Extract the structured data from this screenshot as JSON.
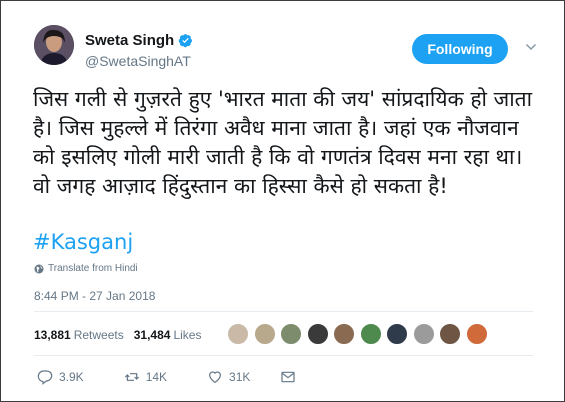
{
  "author": {
    "name": "Sweta Singh",
    "handle": "@SwetaSinghAT",
    "verified": true
  },
  "follow_button_label": "Following",
  "tweet": {
    "text": "जिस गली से गुज़रते हुए 'भारत माता की जय' सांप्रदायिक हो जाता है। जिस मुहल्ले में तिरंगा अवैध माना जाता है। जहां एक नौजवान को इसलिए गोली मारी जाती है कि वो गणतंत्र दिवस मना रहा था। वो जगह आज़ाद हिंदुस्तान का हिस्सा कैसे हो सकता है!",
    "hashtag": "#Kasganj",
    "translate_label": "Translate from Hindi",
    "timestamp": "8:44 PM - 27 Jan 2018"
  },
  "stats": {
    "retweets_count": "13,881",
    "retweets_label": "Retweets",
    "likes_count": "31,484",
    "likes_label": "Likes"
  },
  "likers": [
    {
      "color": "#c9b9a6"
    },
    {
      "color": "#b8a98c"
    },
    {
      "color": "#7e8c6e"
    },
    {
      "color": "#3b3a3a"
    },
    {
      "color": "#8a6b52"
    },
    {
      "color": "#4e8a4e"
    },
    {
      "color": "#2f3b4a"
    },
    {
      "color": "#9b9b9b"
    },
    {
      "color": "#6e5544"
    },
    {
      "color": "#d06a3a"
    }
  ],
  "actions": {
    "reply_count": "3.9K",
    "retweet_count": "14K",
    "like_count": "31K"
  },
  "colors": {
    "accent": "#1da1f2",
    "secondary_text": "#657786"
  }
}
